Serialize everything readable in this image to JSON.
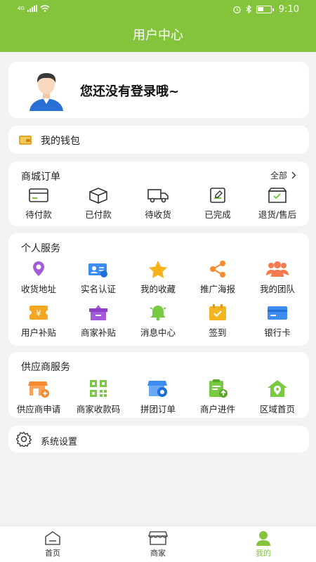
{
  "status_bar": {
    "network": "4G",
    "time": "9:10"
  },
  "header": {
    "title": "用户中心"
  },
  "profile": {
    "login_prompt": "您还没有登录哦~"
  },
  "wallet": {
    "label": "我的钱包"
  },
  "orders": {
    "title": "商城订单",
    "all_label": "全部",
    "items": [
      {
        "label": "待付款",
        "icon": "wallet-card-icon"
      },
      {
        "label": "已付款",
        "icon": "box-icon"
      },
      {
        "label": "待收货",
        "icon": "truck-icon"
      },
      {
        "label": "已完成",
        "icon": "edit-doc-icon"
      },
      {
        "label": "退货/售后",
        "icon": "return-box-icon"
      }
    ]
  },
  "services": {
    "title": "个人服务",
    "items": [
      {
        "label": "收货地址",
        "icon": "location-pin-icon",
        "color": "#a45bd9"
      },
      {
        "label": "实名认证",
        "icon": "id-card-icon",
        "color": "#3d8cf0"
      },
      {
        "label": "我的收藏",
        "icon": "star-icon",
        "color": "#f6b21a"
      },
      {
        "label": "推广海报",
        "icon": "share-icon",
        "color": "#f58a2f"
      },
      {
        "label": "我的团队",
        "icon": "team-icon",
        "color": "#f47b4d"
      },
      {
        "label": "用户补贴",
        "icon": "coupon-yen-icon",
        "color": "#f5a623"
      },
      {
        "label": "商家补贴",
        "icon": "gift-icon",
        "color": "#a45bd9"
      },
      {
        "label": "消息中心",
        "icon": "bell-icon",
        "color": "#7ac943"
      },
      {
        "label": "签到",
        "icon": "calendar-check-icon",
        "color": "#f5b520"
      },
      {
        "label": "银行卡",
        "icon": "bank-card-icon",
        "color": "#3d8cf0"
      }
    ]
  },
  "supplier": {
    "title": "供应商服务",
    "items": [
      {
        "label": "供应商申请",
        "icon": "store-add-icon",
        "color": "#f58a2f"
      },
      {
        "label": "商家收款码",
        "icon": "qr-code-icon",
        "color": "#7ac943"
      },
      {
        "label": "拼团订单",
        "icon": "group-store-icon",
        "color": "#3d8cf0"
      },
      {
        "label": "商户进件",
        "icon": "clipboard-upload-icon",
        "color": "#7ac943"
      },
      {
        "label": "区域首页",
        "icon": "home-pin-icon",
        "color": "#7ac943"
      }
    ]
  },
  "settings": {
    "label": "系统设置"
  },
  "tabbar": {
    "items": [
      {
        "label": "首页",
        "icon": "home-icon"
      },
      {
        "label": "商家",
        "icon": "shop-icon"
      },
      {
        "label": "我的",
        "icon": "user-icon"
      }
    ],
    "active_color": "#84c43c"
  }
}
